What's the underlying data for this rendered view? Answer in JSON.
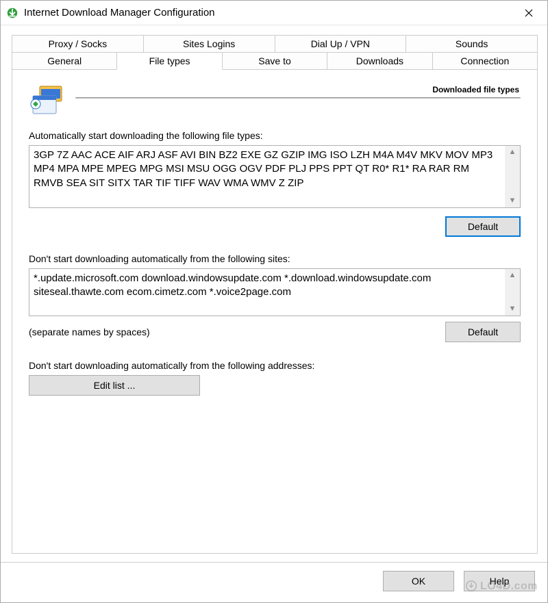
{
  "window": {
    "title": "Internet Download Manager Configuration"
  },
  "tabs": {
    "row1": [
      "Proxy / Socks",
      "Sites Logins",
      "Dial Up / VPN",
      "Sounds"
    ],
    "row2": [
      "General",
      "File types",
      "Save to",
      "Downloads",
      "Connection"
    ],
    "active": "File types"
  },
  "section": {
    "heading": "Downloaded file types"
  },
  "filetypes": {
    "label": "Automatically start downloading the following file types:",
    "value": "3GP 7Z AAC ACE AIF ARJ ASF AVI BIN BZ2 EXE GZ GZIP IMG ISO LZH M4A M4V MKV MOV MP3 MP4 MPA MPE MPEG MPG MSI MSU OGG OGV PDF PLJ PPS PPT QT R0* R1* RA RAR RM RMVB SEA SIT SITX TAR TIF TIFF WAV WMA WMV Z ZIP",
    "default_label": "Default"
  },
  "excluded_sites": {
    "label": "Don't start downloading automatically from the following sites:",
    "value": "*.update.microsoft.com download.windowsupdate.com *.download.windowsupdate.com siteseal.thawte.com ecom.cimetz.com *.voice2page.com",
    "hint": "(separate names by spaces)",
    "default_label": "Default"
  },
  "excluded_addresses": {
    "label": "Don't start downloading automatically from the following addresses:",
    "edit_label": "Edit list ..."
  },
  "footer": {
    "ok": "OK",
    "help": "Help"
  },
  "watermark": "LO4D.com"
}
